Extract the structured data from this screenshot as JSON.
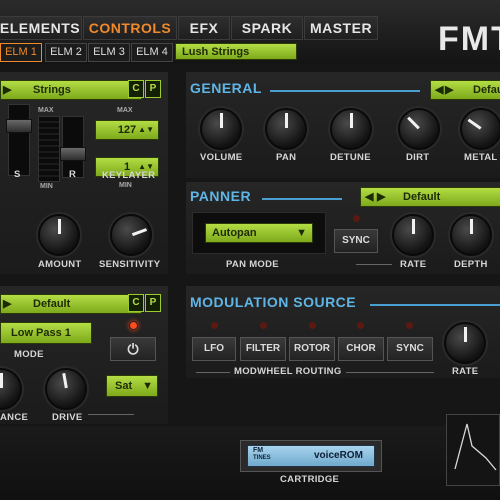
{
  "tabs": [
    "ELEMENTS",
    "CONTROLS",
    "EFX",
    "SPARK",
    "MASTER"
  ],
  "logo": "FMT",
  "elements": [
    "ELM 1",
    "ELM 2",
    "ELM 3",
    "ELM 4"
  ],
  "preset_name": "Lush Strings",
  "layer": {
    "dropdown": "Strings",
    "c": "C",
    "p": "P",
    "max_label": "MAX",
    "min_label": "MIN",
    "slider_s": "S",
    "slider_r": "R",
    "keylayer_max": "127",
    "keylayer_min": "1",
    "keylayer_label": "KEYLAYER",
    "amount_label": "AMOUNT",
    "sensitivity_label": "SENSITIVITY"
  },
  "general": {
    "title": "GENERAL",
    "preset": "Default",
    "knobs": [
      "VOLUME",
      "PAN",
      "DETUNE",
      "DIRT",
      "METAL"
    ]
  },
  "panner": {
    "title": "PANNER",
    "preset": "Default",
    "mode_value": "Autopan",
    "mode_label": "PAN MODE",
    "sync": "SYNC",
    "rate": "RATE",
    "depth": "DEPTH"
  },
  "filter": {
    "preset": "Default",
    "mode_value": "Low Pass 1",
    "mode_label": "MODE",
    "sat": "Sat",
    "resonance_label": "ANCE",
    "drive_label": "DRIVE"
  },
  "modulation": {
    "title": "MODULATION SOURCE",
    "buttons": [
      "LFO",
      "FILTER",
      "ROTOR",
      "CHOR",
      "SYNC"
    ],
    "routing_label": "MODWHEEL ROUTING",
    "rate_label": "RATE"
  },
  "cartridge": {
    "line1": "FM",
    "line2": "TINES",
    "name": "voiceROM",
    "label": "CARTRIDGE"
  },
  "colors": {
    "accent": "#f08a2c",
    "lcd": "#9ccb2e",
    "section": "#5fb6e6"
  }
}
